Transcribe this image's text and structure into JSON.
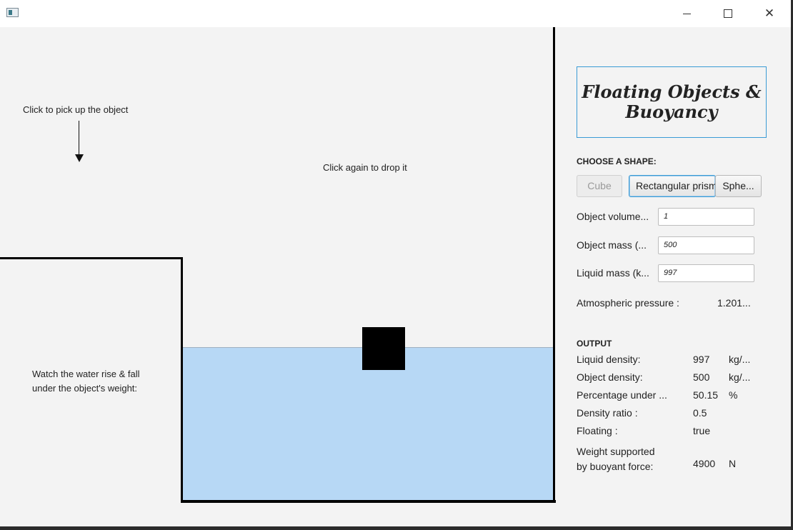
{
  "window": {
    "app_icon": "app-window-icon",
    "minimize_glyph": "",
    "maximize_glyph": "",
    "close_glyph": "✕"
  },
  "simulation": {
    "pick_label": "Click to pick up the object",
    "drop_label": "Click again to drop it",
    "watch_label_line1": "Watch the water rise & fall",
    "watch_label_line2": "under the object's weight:",
    "water_color": "#b7d8f5",
    "object_color": "#000000"
  },
  "panel": {
    "title_line1": "Floating Objects &",
    "title_line2": "Buoyancy",
    "choose_heading": "CHOOSE A SHAPE:",
    "shapes": {
      "cube": "Cube",
      "rect": "Rectangular prism",
      "sphere": "Sphe..."
    },
    "inputs": {
      "volume_label": "Object volume...",
      "volume_value": "1",
      "mass_label": "Object mass (...",
      "mass_value": "500",
      "liquid_label": "Liquid mass (k...",
      "liquid_value": "997"
    },
    "atm_label": "Atmospheric pressure :",
    "atm_value": "1.201...",
    "output_heading": "OUTPUT",
    "output": {
      "liquid_density_label": "Liquid density:",
      "liquid_density_value": "997",
      "liquid_density_unit": "kg/...",
      "object_density_label": "Object density:",
      "object_density_value": "500",
      "object_density_unit": "kg/...",
      "percent_label": "Percentage under ...",
      "percent_value": "50.15",
      "percent_unit": "%",
      "ratio_label": "Density ratio :",
      "ratio_value": "0.5",
      "floating_label": "Floating :",
      "floating_value": "true",
      "weight_label_line1": "Weight supported",
      "weight_label_line2": "by buoyant force:",
      "weight_value": "4900",
      "weight_unit": "N"
    }
  }
}
